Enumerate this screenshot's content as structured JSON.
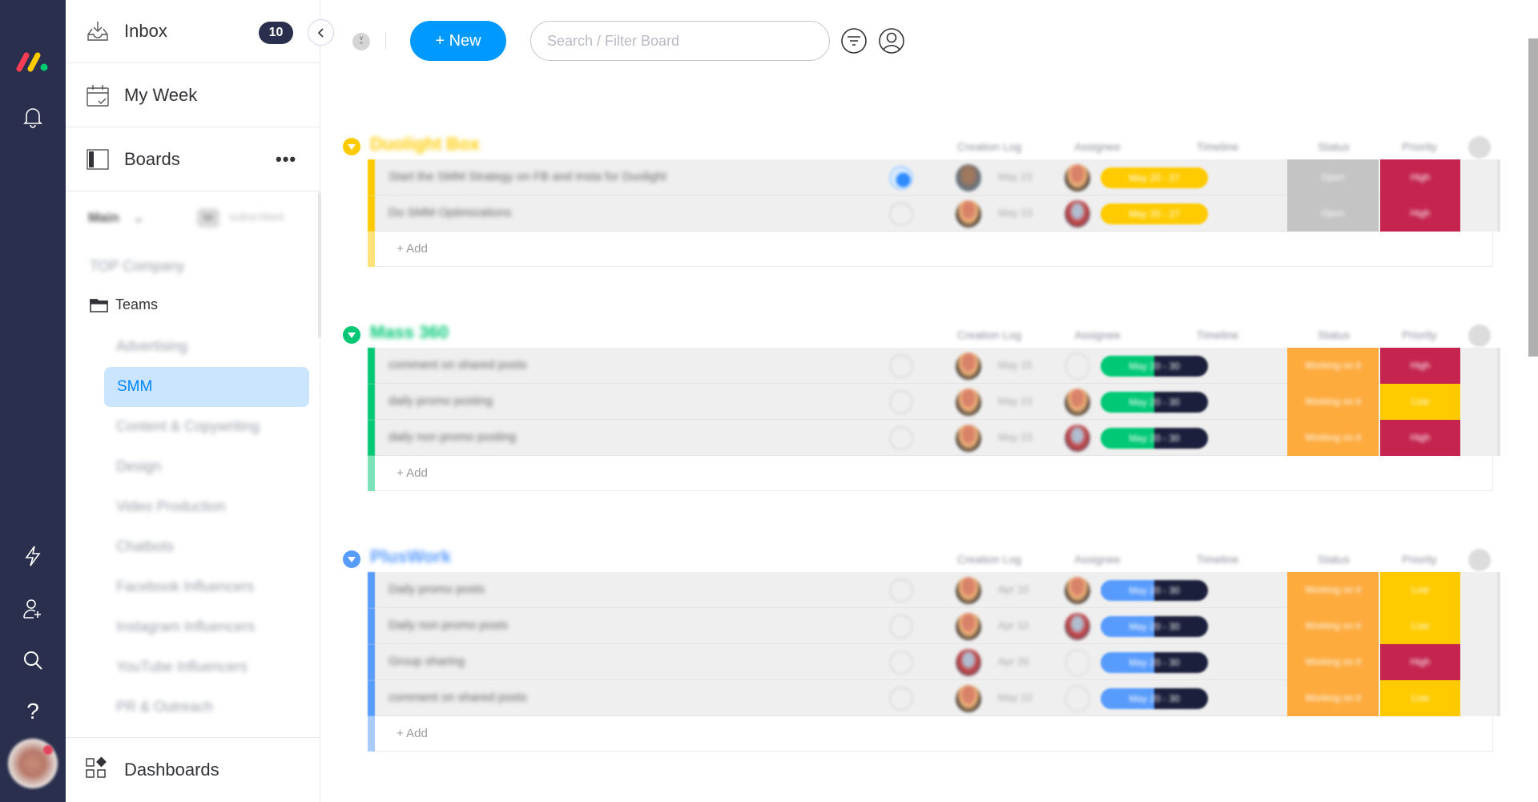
{
  "nav": {
    "logo": "monday-logo",
    "icons": [
      "bell-icon",
      "lightning-icon",
      "invite-user-icon",
      "search-icon",
      "help-icon"
    ],
    "help_label": "?"
  },
  "sidebar": {
    "inbox": {
      "label": "Inbox",
      "count": "10"
    },
    "my_week": {
      "label": "My Week"
    },
    "boards": {
      "label": "Boards",
      "more": "•••"
    },
    "workspace": {
      "name": "Main",
      "chevron": "⌄",
      "badge": "MI",
      "subtitle": "subscribed"
    },
    "company": "TOP Company",
    "folder": "Teams",
    "boards_list": [
      "Advertising",
      "SMM",
      "Content & Copywriting",
      "Design",
      "Video Production",
      "Chatbots",
      "Facebook Influencers",
      "Instagram Influencers",
      "YouTube Influencers",
      "PR & Outreach"
    ],
    "active_board": "SMM",
    "dashboards": {
      "label": "Dashboards"
    }
  },
  "header": {
    "new_label": "+ New",
    "search_placeholder": "Search / Filter Board",
    "search_value": ""
  },
  "columns": [
    "Creation Log",
    "Assignee",
    "Timeline",
    "Status",
    "Priority"
  ],
  "colors": {
    "yellow": "#ffcb00",
    "green": "#00c875",
    "blue": "#579bfc",
    "navy": "#1c1f3b",
    "stuck_gray": "#c4c4c4",
    "working_orange": "#fdab3d",
    "high_red": "#c4244e",
    "low_yellow": "#ffcb00"
  },
  "groups": [
    {
      "title": "Duolight Box",
      "color": "#ffcb00",
      "light": "#ffe37a",
      "rows": [
        {
          "name": "Start the SMM Strategy on FB and Insta for Duolight",
          "update": "active",
          "creator": "person-c",
          "date": "May 23",
          "assignee": "person-a",
          "timeline": "May 20 - 27",
          "timeline_progress": 1.0,
          "timeline_color": "#ffcb00",
          "status": "Open",
          "status_color": "#c4c4c4",
          "priority": "High",
          "priority_color": "#c4244e"
        },
        {
          "name": "Do SMM Optimizations",
          "update": "none",
          "creator": "person-a",
          "date": "May 23",
          "assignee": "person-b",
          "timeline": "May 20 - 27",
          "timeline_progress": 1.0,
          "timeline_color": "#ffcb00",
          "status": "Open",
          "status_color": "#c4c4c4",
          "priority": "High",
          "priority_color": "#c4244e"
        }
      ],
      "add_label": "+ Add"
    },
    {
      "title": "Mass 360",
      "color": "#00c875",
      "light": "#7ee2b8",
      "rows": [
        {
          "name": "comment on shared posts",
          "update": "file",
          "creator": "person-a",
          "date": "May 15",
          "assignee": "empty",
          "timeline": "May 20 - 30",
          "timeline_progress": 0.5,
          "timeline_color": "#00c875",
          "status": "Working on it",
          "status_color": "#fdab3d",
          "priority": "High",
          "priority_color": "#c4244e"
        },
        {
          "name": "daily promo posting",
          "update": "none",
          "creator": "person-a",
          "date": "May 23",
          "assignee": "person-a",
          "timeline": "May 20 - 30",
          "timeline_progress": 0.5,
          "timeline_color": "#00c875",
          "status": "Working on it",
          "status_color": "#fdab3d",
          "priority": "Low",
          "priority_color": "#ffcb00"
        },
        {
          "name": "daily non promo posting",
          "update": "none",
          "creator": "person-a",
          "date": "May 23",
          "assignee": "person-b",
          "timeline": "May 20 - 30",
          "timeline_progress": 0.5,
          "timeline_color": "#00c875",
          "status": "Working on it",
          "status_color": "#fdab3d",
          "priority": "High",
          "priority_color": "#c4244e"
        }
      ],
      "add_label": "+ Add"
    },
    {
      "title": "PlusWork",
      "color": "#579bfc",
      "light": "#a9cbfd",
      "rows": [
        {
          "name": "Daily promo posts",
          "update": "none",
          "creator": "person-a",
          "date": "Apr 10",
          "assignee": "person-a",
          "timeline": "May 20 - 30",
          "timeline_progress": 0.5,
          "timeline_color": "#579bfc",
          "status": "Working on it",
          "status_color": "#fdab3d",
          "priority": "Low",
          "priority_color": "#ffcb00"
        },
        {
          "name": "Daily non promo posts",
          "update": "none",
          "creator": "person-a",
          "date": "Apr 10",
          "assignee": "person-b",
          "timeline": "May 20 - 30",
          "timeline_progress": 0.5,
          "timeline_color": "#579bfc",
          "status": "Working on it",
          "status_color": "#fdab3d",
          "priority": "Low",
          "priority_color": "#ffcb00"
        },
        {
          "name": "Group sharing",
          "update": "none",
          "creator": "person-b",
          "date": "Apr 26",
          "assignee": "empty",
          "timeline": "May 20 - 30",
          "timeline_progress": 0.5,
          "timeline_color": "#579bfc",
          "status": "Working on it",
          "status_color": "#fdab3d",
          "priority": "High",
          "priority_color": "#c4244e"
        },
        {
          "name": "comment on shared posts",
          "update": "file",
          "creator": "person-a",
          "date": "May 10",
          "assignee": "empty",
          "timeline": "May 20 - 30",
          "timeline_progress": 0.5,
          "timeline_color": "#579bfc",
          "status": "Working on it",
          "status_color": "#fdab3d",
          "priority": "Low",
          "priority_color": "#ffcb00"
        }
      ],
      "add_label": "+ Add"
    }
  ]
}
